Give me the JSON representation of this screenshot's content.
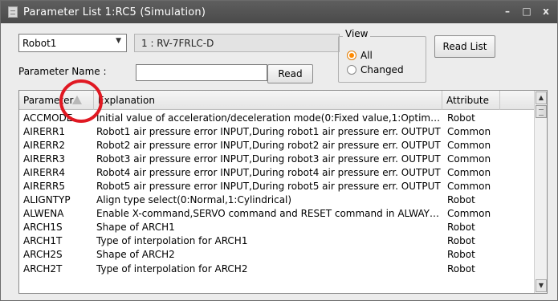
{
  "window": {
    "title": "Parameter List 1:RC5  (Simulation)",
    "controls": {
      "minimize": "–",
      "restore": "□",
      "close": "x"
    }
  },
  "robot_select": {
    "value": "Robot1"
  },
  "model_display": {
    "value": "1 : RV-7FRLC-D"
  },
  "parameter_name": {
    "label": "Parameter Name :",
    "value": ""
  },
  "buttons": {
    "read": "Read",
    "read_list": "Read List"
  },
  "view": {
    "title": "View",
    "options": [
      {
        "label": "All",
        "selected": true
      },
      {
        "label": "Changed",
        "selected": false
      }
    ]
  },
  "table": {
    "headers": [
      "Parameter",
      "Explanation",
      "Attribute"
    ],
    "rows": [
      {
        "name": "ACCMODE",
        "explanation": "Initial value of acceleration/deceleration mode(0:Fixed value,1:Optimum ...",
        "attribute": "Robot"
      },
      {
        "name": "AIRERR1",
        "explanation": "Robot1 air pressure error INPUT,During robot1 air pressure err. OUTPUT",
        "attribute": "Common"
      },
      {
        "name": "AIRERR2",
        "explanation": "Robot2 air pressure error INPUT,During robot2 air pressure err. OUTPUT",
        "attribute": "Common"
      },
      {
        "name": "AIRERR3",
        "explanation": "Robot3 air pressure error INPUT,During robot3 air pressure err. OUTPUT",
        "attribute": "Common"
      },
      {
        "name": "AIRERR4",
        "explanation": "Robot4 air pressure error INPUT,During robot4 air pressure err. OUTPUT",
        "attribute": "Common"
      },
      {
        "name": "AIRERR5",
        "explanation": "Robot5 air pressure error INPUT,During robot5 air pressure err. OUTPUT",
        "attribute": "Common"
      },
      {
        "name": "ALIGNTYP",
        "explanation": "Align type select(0:Normal,1:Cylindrical)",
        "attribute": "Robot"
      },
      {
        "name": "ALWENA",
        "explanation": "Enable X-command,SERVO command and RESET command in ALWAYS ...",
        "attribute": "Common"
      },
      {
        "name": "ARCH1S",
        "explanation": "Shape of ARCH1",
        "attribute": "Robot"
      },
      {
        "name": "ARCH1T",
        "explanation": "Type of interpolation for ARCH1",
        "attribute": "Robot"
      },
      {
        "name": "ARCH2S",
        "explanation": "Shape of ARCH2",
        "attribute": "Robot"
      },
      {
        "name": "ARCH2T",
        "explanation": "Type of interpolation for ARCH2",
        "attribute": "Robot"
      }
    ]
  },
  "colors": {
    "annotation": "#e01822",
    "radio_selected": "#ff8a00",
    "titlebar": "#4a4a4a"
  }
}
